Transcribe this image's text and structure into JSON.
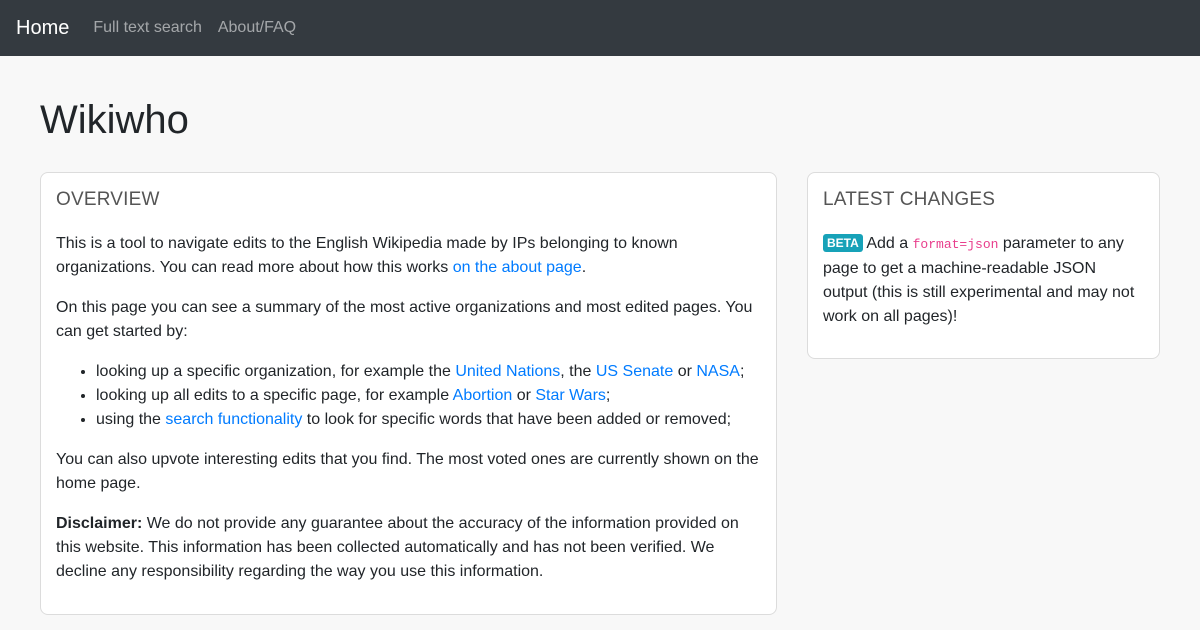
{
  "nav": {
    "brand": "Home",
    "links": [
      "Full text search",
      "About/FAQ"
    ]
  },
  "page_title": "Wikiwho",
  "overview": {
    "title": "OVERVIEW",
    "p1": {
      "text": "This is a tool to navigate edits to the English Wikipedia made by IPs belonging to known organizations. You can read more about how this works ",
      "link": "on the about page",
      "end": "."
    },
    "p2": "On this page you can see a summary of the most active organizations and most edited pages. You can get started by:",
    "list": {
      "item1": {
        "pre": "looking up a specific organization, for example the ",
        "link1": "United Nations",
        "sep1": ", the ",
        "link2": "US Senate",
        "sep2": " or ",
        "link3": "NASA",
        "end": ";"
      },
      "item2": {
        "pre": "looking up all edits to a specific page, for example ",
        "link1": "Abortion",
        "sep1": " or ",
        "link2": "Star Wars",
        "end": ";"
      },
      "item3": {
        "pre": "using the ",
        "link": "search functionality",
        "end": " to look for specific words that have been added or removed;"
      }
    },
    "p3": "You can also upvote interesting edits that you find. The most voted ones are currently shown on the home page.",
    "disclaimer": {
      "label": "Disclaimer:",
      "text": " We do not provide any guarantee about the accuracy of the information provided on this website. This information has been collected automatically and has not been verified. We decline any responsibility regarding the way you use this information."
    }
  },
  "latest_changes": {
    "title": "LATEST CHANGES",
    "badge": "BETA",
    "pre": " Add a ",
    "code": "format=json",
    "post": " parameter to any page to get a machine-readable JSON output (this is still experimental and may not work on all pages)!"
  },
  "colors": {
    "navbar_bg": "#343a40",
    "link": "#007bff",
    "badge_bg": "#17a2b8",
    "code": "#e83e8c",
    "page_bg": "#f8f8f8"
  }
}
